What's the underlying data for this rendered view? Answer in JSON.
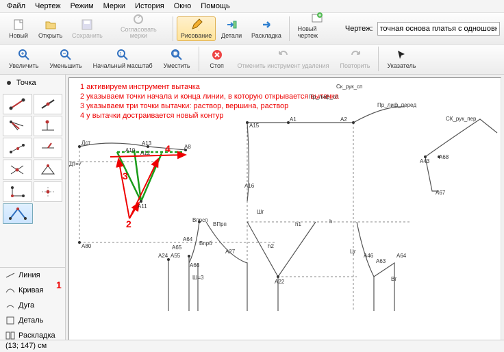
{
  "menu": {
    "file": "Файл",
    "drawing": "Чертеж",
    "mode": "Режим",
    "measurements": "Мерки",
    "history": "История",
    "window": "Окно",
    "help": "Помощь"
  },
  "toolbar1": {
    "new": "Новый",
    "open": "Открыть",
    "save": "Сохранить",
    "sync": "Согласовать мерки",
    "draw": "Рисование",
    "details": "Детали",
    "layout": "Раскладка",
    "new_drawing": "Новый чертеж",
    "drawing_label": "Чертеж:",
    "drawing_value": "точная основа платья с одношовным рука"
  },
  "toolbar2": {
    "zoom_in": "Увеличить",
    "zoom_out": "Уменьшить",
    "zoom_orig": "Начальный масштаб",
    "fit": "Уместить",
    "stop": "Стоп",
    "undo": "Отменить инструмент удаления",
    "redo": "Повторить",
    "pointer": "Указатель"
  },
  "left": {
    "point": "Точка",
    "sections": {
      "line": "Линия",
      "curve": "Кривая",
      "arc": "Дуга",
      "detail": "Деталь",
      "layout": "Раскладка"
    }
  },
  "instructions": {
    "l1": "1 активируем инструмент вытачка",
    "l2": "2 указываем точки начала и конца линии, в которую открывается вытачка",
    "l3": "3 указываем три точки вытачки: раствор, вершина, раствор",
    "l4": "4 у вытачки достраивается новый контур"
  },
  "labels": {
    "dst": "Дст",
    "dt7": "Дт=7",
    "a80": "А80",
    "a24": "А24",
    "a55": "А55",
    "vpr": "Впрсп",
    "a64": "А64",
    "a65": "А65",
    "a66": "А66",
    "vprb": "Впрб",
    "sh3": "Ш=3",
    "a13": "А13",
    "a12": "А12",
    "a10": "А10",
    "a11": "А11",
    "a8": "А8",
    "a15": "А15",
    "a16": "А16",
    "sht": "Шг",
    "vprp": "ВПрп",
    "a27": "А27",
    "h2": "h2",
    "a22": "А22",
    "h1": "h1",
    "h": "h",
    "ur": "Цг",
    "a46": "А46",
    "a63": "А63",
    "a64r": "А64",
    "br": "Вг",
    "a1": "А1",
    "a2": "А2",
    "pr_lif_sp": "Пр_лиф_сп",
    "sk_ruk_sp": "Ск_рук_сп",
    "a43": "А43",
    "a68": "А68",
    "a67": "А67",
    "pr_lif_pered": "Пр_лиф_перед",
    "sk_ruk_per": "СК_рук_пер"
  },
  "anno": {
    "n1": "1",
    "n2": "2",
    "n3": "3",
    "n4": "4"
  },
  "status": "(13; 147) см"
}
